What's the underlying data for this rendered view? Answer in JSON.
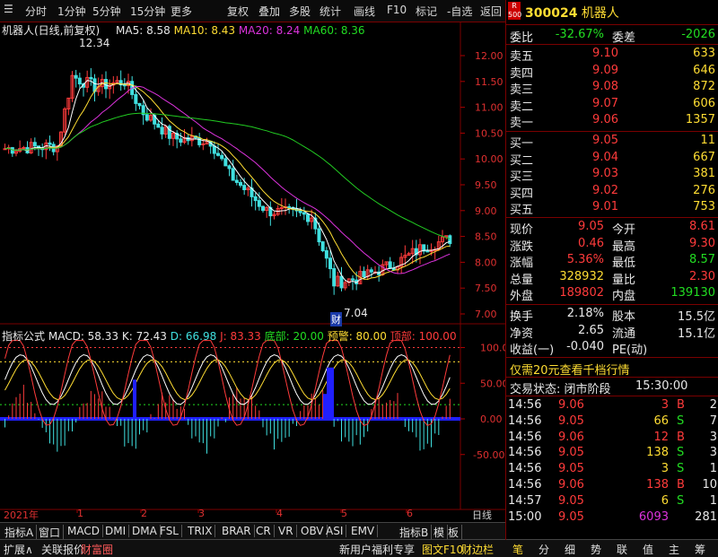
{
  "toolbar": {
    "items": [
      "分时",
      "1分钟",
      "5分钟",
      "15分钟",
      "更多",
      "复权",
      "叠加",
      "多股",
      "统计",
      "画线",
      "F10",
      "标记",
      "-自选",
      "返回"
    ]
  },
  "kline_title": {
    "name": "机器人(日线,前复权)",
    "ma5": "MA5: 8.58",
    "ma10": "MA10: 8.43",
    "ma20": "MA20: 8.24",
    "ma60": "MA60: 8.36"
  },
  "price_axis": [
    "12.00",
    "11.50",
    "11.00",
    "10.50",
    "10.00",
    "9.50",
    "9.00",
    "8.50",
    "8.00",
    "7.50",
    "7.00"
  ],
  "annotations": {
    "high": "12.34",
    "low": "7.04",
    "cai": "财"
  },
  "indicator_title": {
    "name": "指标公式",
    "macd": "MACD: 58.33",
    "k": "K: 72.43",
    "d": "D: 66.98",
    "j": "J: 83.33",
    "bottom": "底部: 20.00",
    "warn": "预警: 80.00",
    "top": "顶部: 100.00"
  },
  "indicator_axis": [
    "100.0",
    "50.00",
    "0.00",
    "-50.00"
  ],
  "time_axis": {
    "year": "2021年",
    "months": [
      "1",
      "2",
      "3",
      "4",
      "5",
      "6"
    ],
    "period": "日线"
  },
  "tabs_row1": [
    "指标A",
    "窗口",
    "MACD",
    "DMI",
    "DMA",
    "FSL",
    "TRIX",
    "BRAR",
    "CR",
    "VR",
    "OBV",
    "ASI",
    "EMV",
    "指标B",
    "模",
    "板"
  ],
  "tabs_row2": {
    "left": [
      "扩展∧",
      "关联报价",
      "财富圈"
    ],
    "mid": [
      "新用户福利专享",
      "图文F10",
      "财边栏"
    ],
    "right": [
      "笔",
      "分",
      "细",
      "势",
      "联",
      "值",
      "主",
      "筹"
    ]
  },
  "quote": {
    "code": "300024",
    "name": "机器人",
    "weibi": {
      "label": "委比",
      "value": "-32.67%"
    },
    "weicha": {
      "label": "委差",
      "value": "-2026"
    },
    "sells": [
      {
        "label": "卖五",
        "price": "9.10",
        "vol": "633"
      },
      {
        "label": "卖四",
        "price": "9.09",
        "vol": "646"
      },
      {
        "label": "卖三",
        "price": "9.08",
        "vol": "872"
      },
      {
        "label": "卖二",
        "price": "9.07",
        "vol": "606"
      },
      {
        "label": "卖一",
        "price": "9.06",
        "vol": "1357"
      }
    ],
    "buys": [
      {
        "label": "买一",
        "price": "9.05",
        "vol": "11"
      },
      {
        "label": "买二",
        "price": "9.04",
        "vol": "667"
      },
      {
        "label": "买三",
        "price": "9.03",
        "vol": "381"
      },
      {
        "label": "买四",
        "price": "9.02",
        "vol": "276"
      },
      {
        "label": "买五",
        "price": "9.01",
        "vol": "753"
      }
    ],
    "stats": [
      {
        "l1": "现价",
        "v1": "9.05",
        "l2": "今开",
        "v2": "8.61"
      },
      {
        "l1": "涨跌",
        "v1": "0.46",
        "l2": "最高",
        "v2": "9.30"
      },
      {
        "l1": "涨幅",
        "v1": "5.36%",
        "l2": "最低",
        "v2": "8.57"
      },
      {
        "l1": "总量",
        "v1": "328932",
        "l2": "量比",
        "v2": "2.30"
      },
      {
        "l1": "外盘",
        "v1": "189802",
        "l2": "内盘",
        "v2": "139130"
      }
    ],
    "stats2": [
      {
        "l1": "换手",
        "v1": "2.18%",
        "l2": "股本",
        "v2": "15.5亿"
      },
      {
        "l1": "净资",
        "v1": "2.65",
        "l2": "流通",
        "v2": "15.1亿"
      },
      {
        "l1": "收益(一)",
        "v1": "-0.040",
        "l2": "PE(动)",
        "v2": ""
      }
    ],
    "promo": "仅需20元查看千档行情",
    "trade_status": "交易状态: 闭市阶段",
    "trade_time": "15:30:00",
    "ticks": [
      {
        "t": "14:56",
        "p": "9.06",
        "v": "3",
        "s": "B",
        "n": "2"
      },
      {
        "t": "14:56",
        "p": "9.05",
        "v": "66",
        "s": "S",
        "n": "7"
      },
      {
        "t": "14:56",
        "p": "9.06",
        "v": "12",
        "s": "B",
        "n": "3"
      },
      {
        "t": "14:56",
        "p": "9.05",
        "v": "138",
        "s": "S",
        "n": "3"
      },
      {
        "t": "14:56",
        "p": "9.05",
        "v": "3",
        "s": "S",
        "n": "1"
      },
      {
        "t": "14:56",
        "p": "9.06",
        "v": "138",
        "s": "B",
        "n": "10"
      },
      {
        "t": "14:57",
        "p": "9.05",
        "v": "6",
        "s": "S",
        "n": "1"
      },
      {
        "t": "15:00",
        "p": "9.05",
        "v": "6093",
        "s": "",
        "n": "281"
      }
    ]
  },
  "colors": {
    "up": "#ff3b3b",
    "down": "#22dd22",
    "ma5": "#ffffff",
    "ma10": "#ffdd33",
    "ma20": "#dd33dd",
    "ma60": "#22cc22",
    "macd_bar": "#2020ff"
  }
}
